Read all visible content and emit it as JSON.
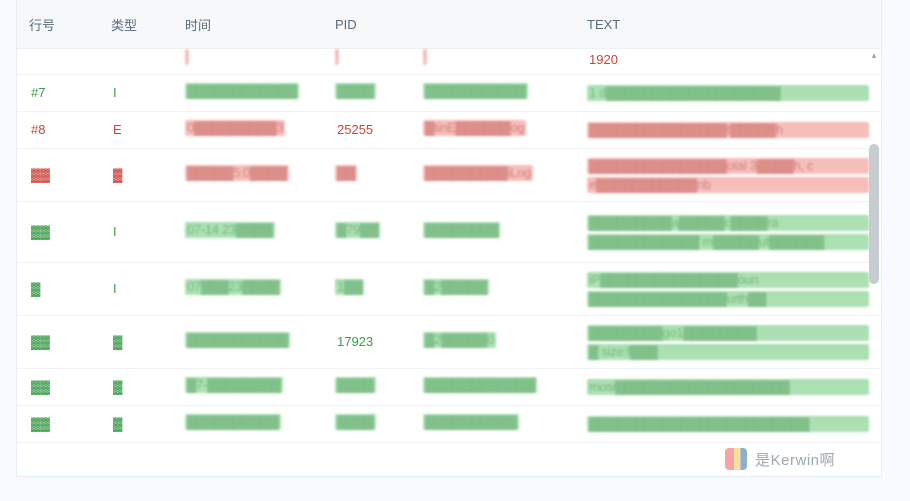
{
  "columns": {
    "row": "行号",
    "type": "类型",
    "time": "时间",
    "pid": "PID",
    "tag": "",
    "text": "TEXT"
  },
  "rows": [
    {
      "style": "compact",
      "cls": "r",
      "row": "",
      "type": "",
      "time": "",
      "pid": "",
      "tag": "",
      "text": "1920"
    },
    {
      "style": "",
      "cls": "g",
      "row": "#7",
      "type": "I",
      "time": "▓▓▓▓▓▓▓▓▓▓▓▓",
      "pid": "▓▓▓▓",
      "tag": "▓▓▓▓▓▓▓▓▓▓▓",
      "text": "1 d▓▓▓▓▓▓▓▓▓▓▓▓▓▓▓▓▓▓▓"
    },
    {
      "style": "",
      "cls": "r",
      "row": "#8",
      "type": "E",
      "time": "0▓▓▓▓▓▓▓▓▓3",
      "pid": "25255",
      "tag": "▓tinE▓▓▓▓▓▓og",
      "text": "▓▓▓▓▓▓▓▓▓▓▓▓▓▓▓t▓▓▓▓▓h"
    },
    {
      "style": "tall",
      "cls": "r",
      "row": "▓▓",
      "type": "▓",
      "time": "▓▓▓▓▓5:0▓▓▓▓",
      "pid": "▓▓",
      "tag": "▓▓▓▓▓▓▓▓▓iLog",
      "text": "▓▓▓▓▓▓▓▓▓▓▓▓▓▓▓otal 3▓▓▓▓h, c",
      "text2": "e▓▓▓▓▓▓▓▓▓▓▓nb"
    },
    {
      "style": "lg",
      "cls": "g",
      "row": "▓▓",
      "type": "I",
      "time": "07-14 23▓▓▓▓",
      "pid": "▓79▓▓",
      "tag": "▓▓▓▓▓▓▓▓",
      "text": "▓▓▓▓▓▓▓▓▓a▓▓▓▓▓c▓▓▓▓ra",
      "text2": "▓▓▓▓▓▓▓▓▓▓▓▓ m▓▓▓▓▓ut▓▓▓▓▓▓"
    },
    {
      "style": "tall",
      "cls": "g",
      "row": "▓",
      "type": "I",
      "time": "07▓▓▓23▓▓▓▓",
      "pid": "1▓▓",
      "tag": "▓2▓▓▓▓▓",
      "text": "iP▓▓▓▓▓▓▓▓▓▓▓▓▓▓▓oun",
      "text2": "▓▓▓▓▓▓▓▓▓▓▓▓▓▓▓urth▓▓"
    },
    {
      "style": "tall",
      "cls": "g",
      "row": "▓▓",
      "type": "▓",
      "time": "▓▓▓▓▓▓▓▓▓▓▓",
      "pid": "17923",
      "tag": "▓2▓▓▓▓▓0",
      "text": "▓▓▓▓▓▓▓▓go1▓▓▓▓▓▓▓▓",
      "text2": "▓ size:f▓▓▓"
    },
    {
      "style": "",
      "cls": "g",
      "row": "▓▓",
      "type": "▓",
      "time": "▓7-▓▓▓▓▓▓▓▓",
      "pid": "▓▓▓▓",
      "tag": "▓▓▓▓▓▓▓▓▓▓▓▓",
      "text": "mosi▓▓▓▓▓▓▓▓▓▓▓▓▓▓▓▓▓▓▓"
    },
    {
      "style": "",
      "cls": "g",
      "row": "▓▓",
      "type": "▓",
      "time": "▓▓▓▓▓▓▓▓▓▓",
      "pid": "▓▓▓▓",
      "tag": "▓▓▓▓▓▓▓▓▓▓",
      "text": "▓▓▓▓▓▓▓▓▓▓▓▓▓▓▓▓▓▓▓▓▓▓▓▓"
    }
  ],
  "watermark": {
    "text": "是Kerwin啊"
  }
}
